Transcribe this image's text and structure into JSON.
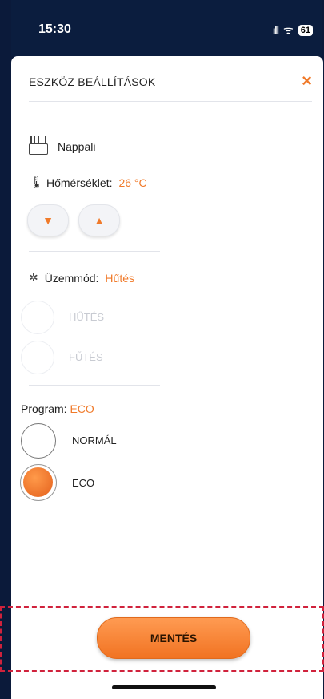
{
  "status_bar": {
    "time": "15:30",
    "signal": ":::!",
    "wifi": "wifi",
    "battery": "61"
  },
  "sheet": {
    "title": "ESZKÖZ BEÁLLÍTÁSOK",
    "close_icon": "×"
  },
  "device": {
    "icon": "ac-unit-icon",
    "name": "Nappali"
  },
  "temperature": {
    "label": "Hőmérséklet:",
    "value": "26 °C",
    "down_icon": "▼",
    "up_icon": "▲"
  },
  "mode": {
    "label": "Üzemmód:",
    "value": "Hűtés",
    "options": [
      "HŰTÉS",
      "FŰTÉS"
    ]
  },
  "program": {
    "label": "Program:",
    "value": "ECO",
    "options": [
      "NORMÁL",
      "ECO"
    ],
    "selected": "ECO"
  },
  "actions": {
    "save_label": "MENTÉS"
  },
  "colors": {
    "accent": "#f07a2a",
    "highlight": "#d0223c"
  }
}
